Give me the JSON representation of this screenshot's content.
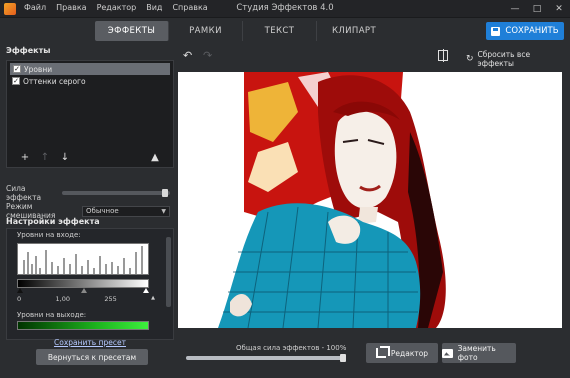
{
  "window": {
    "title": "Студия Эффектов 4.0",
    "menu": [
      "Файл",
      "Правка",
      "Редактор",
      "Вид",
      "Справка"
    ],
    "controls": [
      "minimize-icon",
      "maximize-icon",
      "close-icon"
    ]
  },
  "tabs": [
    {
      "label": "ЭФФЕКТЫ",
      "active": true
    },
    {
      "label": "РАМКИ",
      "active": false
    },
    {
      "label": "ТЕКСТ",
      "active": false
    },
    {
      "label": "КЛИПАРТ",
      "active": false
    }
  ],
  "save_button": {
    "label": "СОХРАНИТЬ",
    "color": "#1f7fd8"
  },
  "effects_panel": {
    "title": "Эффекты",
    "items": [
      {
        "label": "Уровни",
        "checked": true,
        "selected": true
      },
      {
        "label": "Оттенки серого",
        "checked": true,
        "selected": false
      }
    ],
    "tools": [
      "add-icon",
      "move-up-icon",
      "move-down-icon",
      "delete-icon"
    ]
  },
  "effect_strength": {
    "label": "Сила эффекта",
    "value": 1.0
  },
  "blend_mode": {
    "label": "Режим смешивания",
    "value": "Обычное"
  },
  "settings": {
    "title": "Настройки эффекта",
    "input_levels_label": "Уровни на входе:",
    "input_values": [
      "0",
      "1,00",
      "255"
    ],
    "output_levels_label": "Уровни на выходе:"
  },
  "save_preset_link": "Сохранить пресет",
  "back_to_presets_button": "Вернуться к пресетам",
  "toolbar": {
    "reset_label": "Сбросить все эффекты"
  },
  "bottom": {
    "overall_strength_label": "Общая сила эффектов - 100%",
    "overall_strength_value": 1.0,
    "editor_button": "Редактор",
    "replace_photo_button": "Заменить фото"
  }
}
